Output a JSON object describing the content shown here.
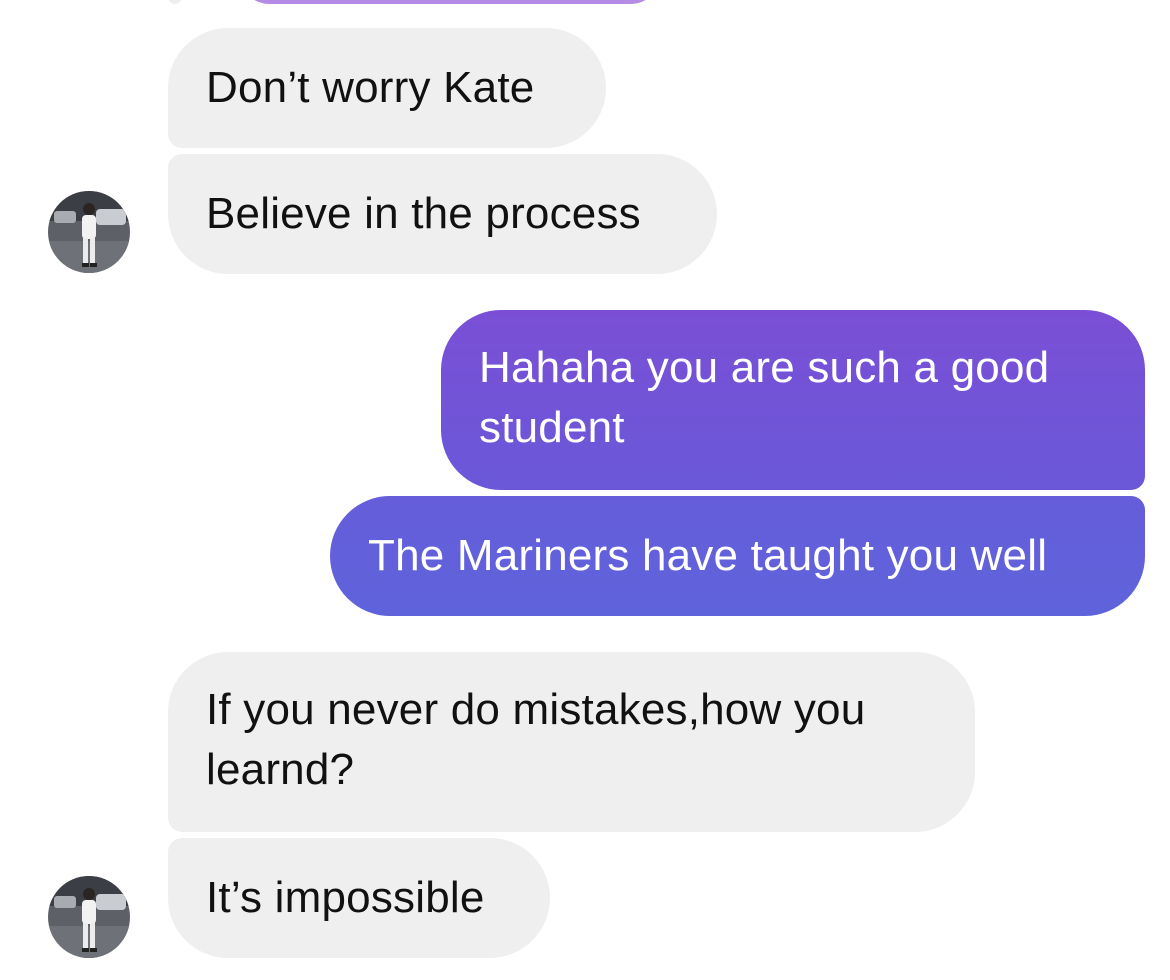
{
  "conversation": {
    "messages": [
      {
        "sender": "other",
        "text": ""
      },
      {
        "sender": "other",
        "text": "Don’t worry Kate"
      },
      {
        "sender": "other",
        "text": "Believe in the process"
      },
      {
        "sender": "me",
        "text": "Hahaha you are such a good student"
      },
      {
        "sender": "me",
        "text": "The Mariners have taught you well"
      },
      {
        "sender": "other",
        "text": "If you never do mistakes,how you learnd?"
      },
      {
        "sender": "other",
        "text": "It’s impossible"
      }
    ]
  },
  "colors": {
    "received_bubble": "#efefef",
    "sent_gradient_top": "#7a4fd6",
    "sent_gradient_bottom": "#5f63db",
    "top_partial_bubble": "#b58be6"
  },
  "icons": {
    "contact_avatar": "avatar-photo"
  }
}
